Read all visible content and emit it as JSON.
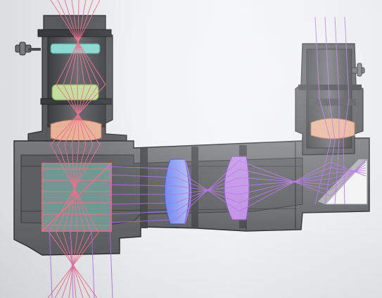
{
  "scene": {
    "subject": "optical-ray-trace-cad",
    "colors": {
      "background": "#eceef0",
      "housing": "#6e6f72",
      "housing_dark": "#454649",
      "housing_light": "#8c8d90",
      "edge": "#2c2c2e",
      "ray_pink": "#f06e8e",
      "ray_violet": "#b36ce6",
      "lens_cyan": "#8fe0d6",
      "lens_green": "#c8e6a0",
      "lens_peach": "#f0b79a",
      "lens_blue": "#8ea6ff",
      "lens_purple": "#c994f2",
      "prism_grey": "#c9cacc",
      "mirror_white": "#f2f2f2"
    },
    "components": [
      "left-eyepiece-tube",
      "right-eyepiece-tube",
      "focus-knob-left",
      "focus-knob-right",
      "main-body",
      "beam-splitter-cube",
      "relay-lens-1",
      "relay-lens-2",
      "fold-mirror-prism",
      "ray-bundle-pink",
      "ray-bundle-violet"
    ]
  }
}
